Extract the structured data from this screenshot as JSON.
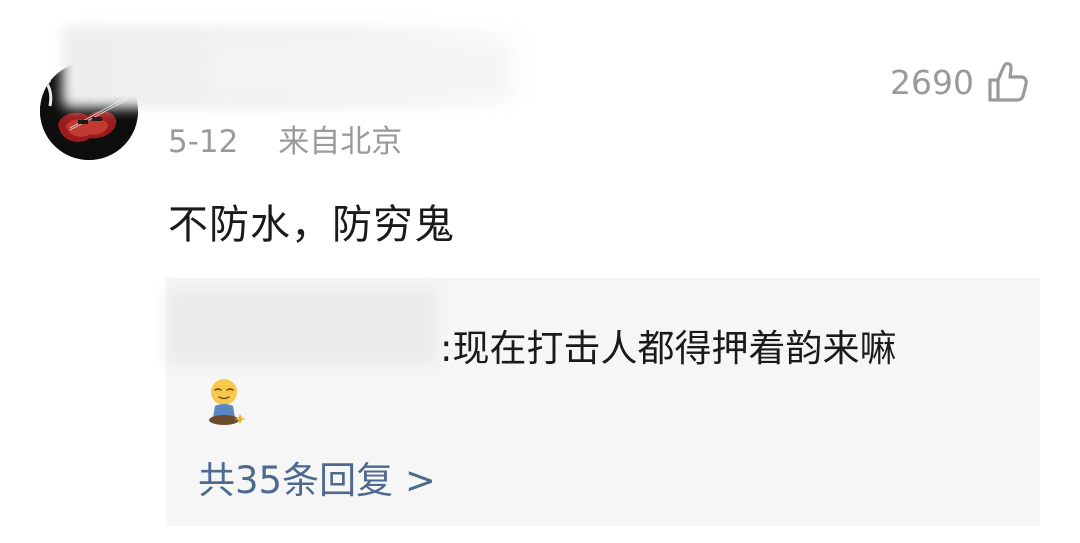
{
  "comment": {
    "date": "5-12",
    "location": "来自北京",
    "like_count": "2690",
    "text": "不防水，防穷鬼",
    "icons": {
      "avatar": "guitar-avatar-icon",
      "like": "thumbs-up-icon"
    }
  },
  "reply": {
    "text": ":现在打击人都得押着韵来嘛",
    "emoji": "meditating-emoji-icon",
    "more_label": "共35条回复 >"
  }
}
